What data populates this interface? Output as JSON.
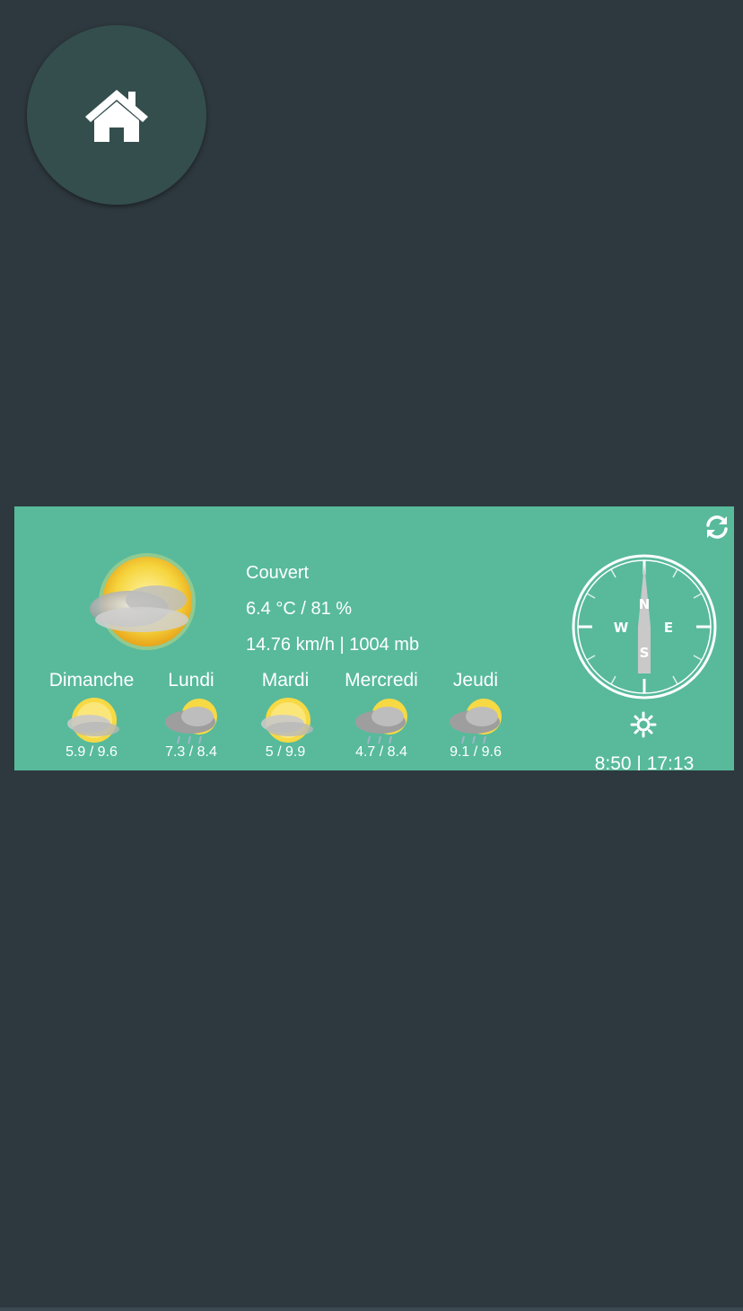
{
  "home_button": {
    "icon": "home-icon"
  },
  "weather": {
    "condition": "Couvert",
    "temp_humidity": "6.4 °C / 81 %",
    "wind_pressure": "14.76 km/h | 1004 mb",
    "main_icon": "partly-cloudy-icon",
    "refresh_icon": "refresh-icon",
    "forecast": [
      {
        "day": "Dimanche",
        "temps": "5.9 / 9.6",
        "icon": "partly-cloudy-icon"
      },
      {
        "day": "Lundi",
        "temps": "7.3 / 8.4",
        "icon": "cloudy-rain-icon"
      },
      {
        "day": "Mardi",
        "temps": "5 / 9.9",
        "icon": "partly-cloudy-icon"
      },
      {
        "day": "Mercredi",
        "temps": "4.7 / 8.4",
        "icon": "cloudy-rain-icon"
      },
      {
        "day": "Jeudi",
        "temps": "9.1 / 9.6",
        "icon": "cloudy-rain-icon"
      }
    ],
    "compass": {
      "north": "N",
      "south": "S",
      "east": "E",
      "west": "W",
      "wind_direction_deg": 0
    },
    "sun_icon": "sun-icon",
    "sun_times": "8:50 | 17:13"
  },
  "colors": {
    "background": "#2e393f",
    "widget": "#58ba9b",
    "home_button": "#344e4d",
    "text": "#ffffff"
  }
}
